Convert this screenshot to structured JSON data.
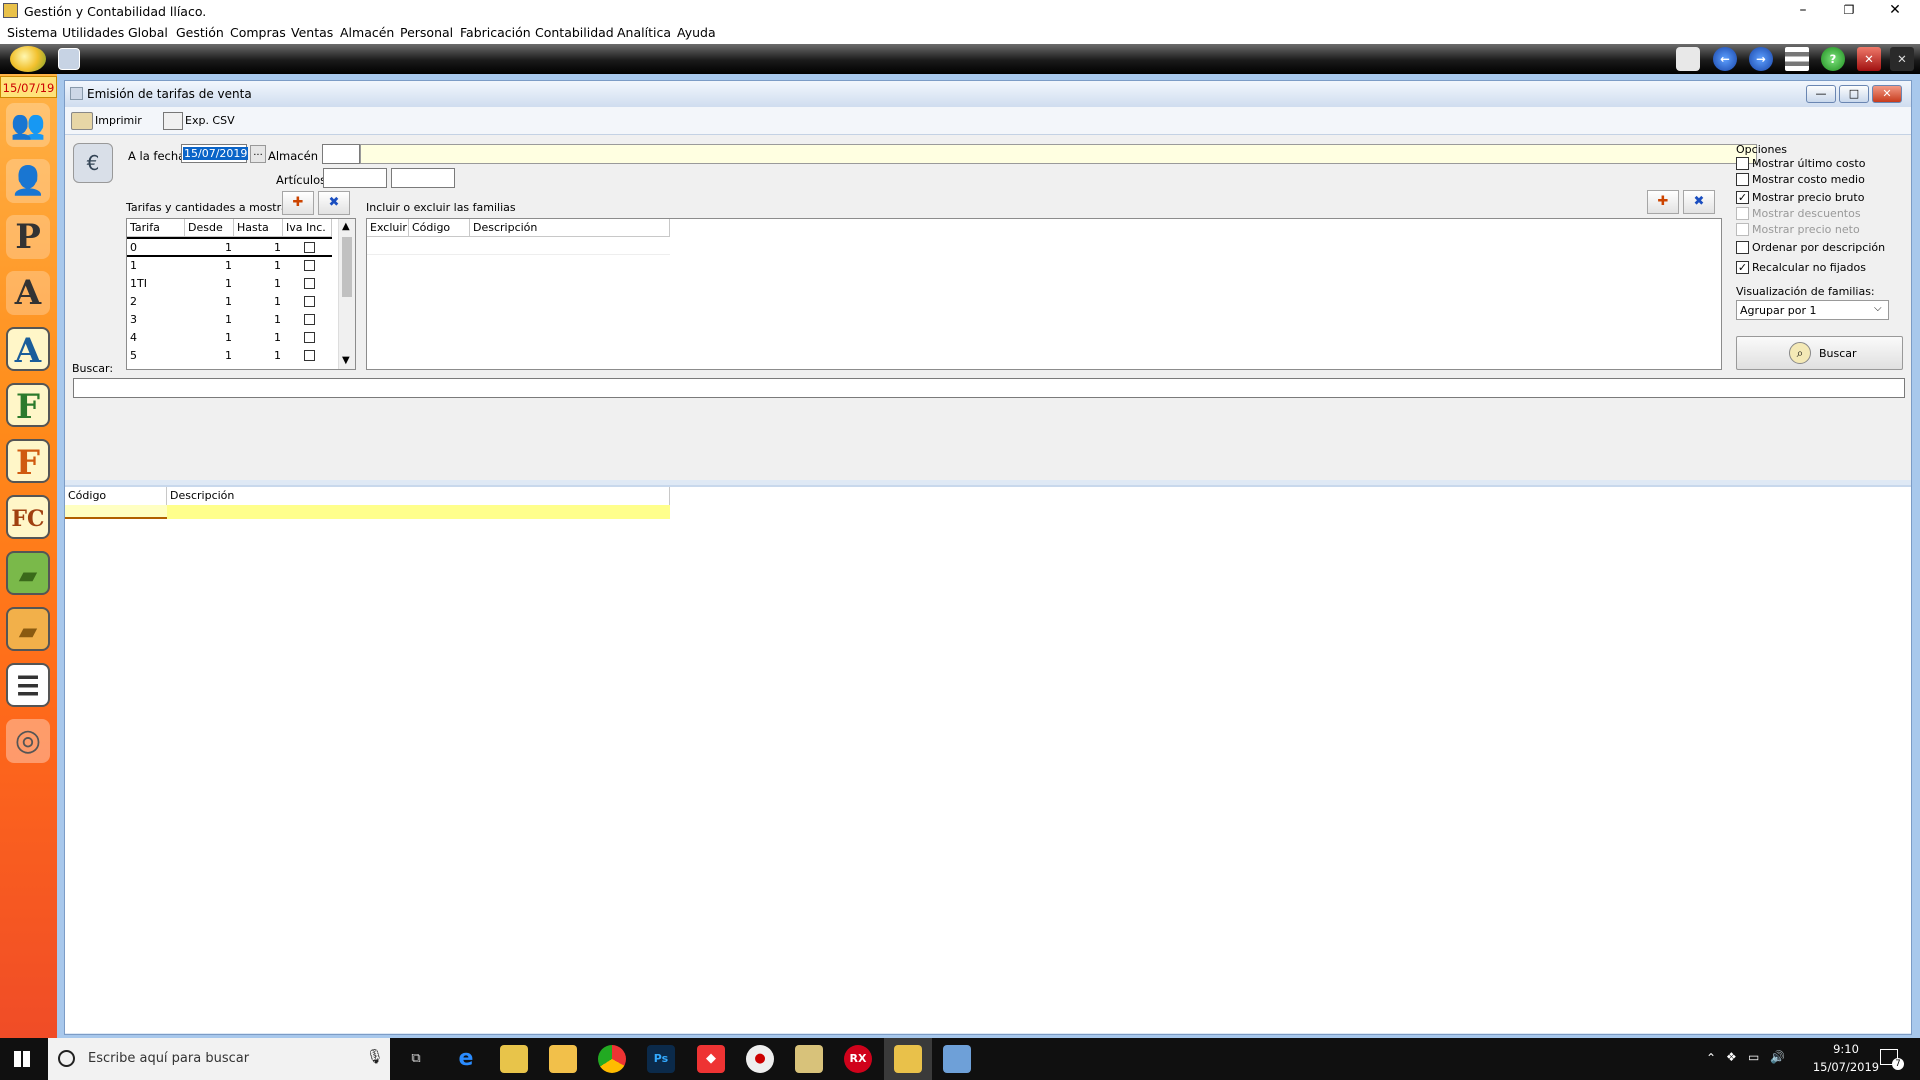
{
  "window": {
    "title": "Gestión y Contabilidad llíaco.",
    "minimize": "–",
    "restore": "❐",
    "close": "✕"
  },
  "menu": [
    "Sistema",
    "Utilidades",
    "Global",
    "Gestión",
    "Compras",
    "Ventas",
    "Almacén",
    "Personal",
    "Fabricación",
    "Contabilidad",
    "Analítica",
    "Ayuda"
  ],
  "sidebar": {
    "date": "15/07/19",
    "icons": [
      {
        "name": "users-group-icon",
        "glyph": "👥"
      },
      {
        "name": "user-icon",
        "glyph": "👤"
      },
      {
        "name": "user-p-icon",
        "glyph": "P"
      },
      {
        "name": "user-a-icon",
        "glyph": "A"
      },
      {
        "name": "letter-a-icon",
        "glyph": "A"
      },
      {
        "name": "letter-f-icon",
        "glyph": "F"
      },
      {
        "name": "letter-f-orange-icon",
        "glyph": "F"
      },
      {
        "name": "fc-icon",
        "glyph": "FC"
      },
      {
        "name": "bag-green-icon",
        "glyph": "▰"
      },
      {
        "name": "bag-orange-icon",
        "glyph": "▰"
      },
      {
        "name": "list-icon",
        "glyph": "☰"
      },
      {
        "name": "disc-icon",
        "glyph": "◎"
      }
    ]
  },
  "child": {
    "title": "Emisión de tarifas de venta",
    "min": "—",
    "max": "□",
    "close": "✕"
  },
  "actions": {
    "print": "Imprimir",
    "csv": "Exp. CSV"
  },
  "form": {
    "date_label": "A la fecha",
    "date_value": "15/07/2019",
    "ellipsis": "...",
    "warehouse_label": "Almacén",
    "articles_label": "Artículos",
    "search_label": "Buscar:"
  },
  "tarifas": {
    "label": "Tarifas y cantidades a mostrar",
    "headers": [
      "Tarifa",
      "Desde",
      "Hasta",
      "Iva Inc."
    ],
    "rows": [
      [
        "0",
        "1",
        "1"
      ],
      [
        "1",
        "1",
        "1"
      ],
      [
        "1TI",
        "1",
        "1"
      ],
      [
        "2",
        "1",
        "1"
      ],
      [
        "3",
        "1",
        "1"
      ],
      [
        "4",
        "1",
        "1"
      ],
      [
        "5",
        "1",
        "1"
      ]
    ]
  },
  "familias": {
    "label": "Incluir o excluir las familias",
    "headers": [
      "Excluir",
      "Código",
      "Descripción"
    ]
  },
  "opciones": {
    "title": "Opciones",
    "items": [
      {
        "label": "Mostrar último costo",
        "checked": false,
        "enabled": true
      },
      {
        "label": "Mostrar costo medio",
        "checked": false,
        "enabled": true
      },
      {
        "label": "Mostrar precio bruto",
        "checked": true,
        "enabled": true
      },
      {
        "label": "Mostrar descuentos",
        "checked": false,
        "enabled": false
      },
      {
        "label": "Mostrar precio neto",
        "checked": false,
        "enabled": false
      },
      {
        "label": "Ordenar por descripción",
        "checked": false,
        "enabled": true
      },
      {
        "label": "Recalcular no fijados",
        "checked": true,
        "enabled": true
      }
    ],
    "vis_label": "Visualización de familias:",
    "vis_value": "Agrupar por 1",
    "search_button": "Buscar"
  },
  "results": {
    "headers": [
      "Código",
      "Descripción"
    ]
  },
  "taskbar": {
    "search_placeholder": "Escribe aquí para buscar",
    "time": "9:10",
    "date": "15/07/2019",
    "notifications": "7"
  }
}
